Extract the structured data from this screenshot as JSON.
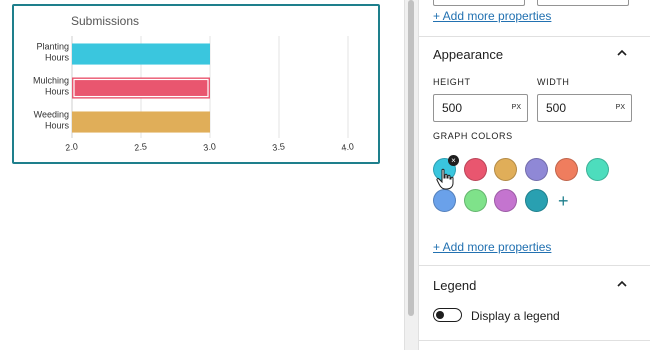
{
  "chart_data": {
    "type": "bar",
    "orientation": "horizontal",
    "title": "Submissions",
    "categories": [
      "Planting Hours",
      "Mulching Hours",
      "Weeding Hours"
    ],
    "category_lines": [
      [
        "Planting",
        "Hours"
      ],
      [
        "Mulching",
        "Hours"
      ],
      [
        "Weeding",
        "Hours"
      ]
    ],
    "values": [
      3.0,
      3.0,
      3.0
    ],
    "colors": [
      "#3ac6de",
      "#e9566f",
      "#e0ae59"
    ],
    "xlim": [
      2.0,
      4.0
    ],
    "xticks": [
      "2.0",
      "2.5",
      "3.0",
      "3.5",
      "4.0"
    ],
    "xtick_values": [
      2.0,
      2.5,
      3.0,
      3.5,
      4.0
    ],
    "grid": true,
    "selected_index": 1,
    "xlabel": "",
    "ylabel": ""
  },
  "panel": {
    "top_link": "+ Add more properties",
    "appearance": {
      "title": "Appearance",
      "height_label": "HEIGHT",
      "height_value": "500",
      "height_unit": "PX",
      "width_label": "WIDTH",
      "width_value": "500",
      "width_unit": "PX",
      "colors_label": "GRAPH COLORS",
      "colors": [
        "#3ac6de",
        "#e9566f",
        "#e0ae59",
        "#8f88d6",
        "#ef7d5e",
        "#4dddbd",
        "#6aa1ea",
        "#7fe28a",
        "#c474cf",
        "#29a0b1"
      ],
      "remove_badge": "×",
      "add_color": "+",
      "add_link": "+ Add more properties"
    },
    "legend": {
      "title": "Legend",
      "toggle_label": "Display a legend",
      "display_legend": false
    }
  },
  "accent": "#1e7f8c",
  "link_color": "#2271b1"
}
